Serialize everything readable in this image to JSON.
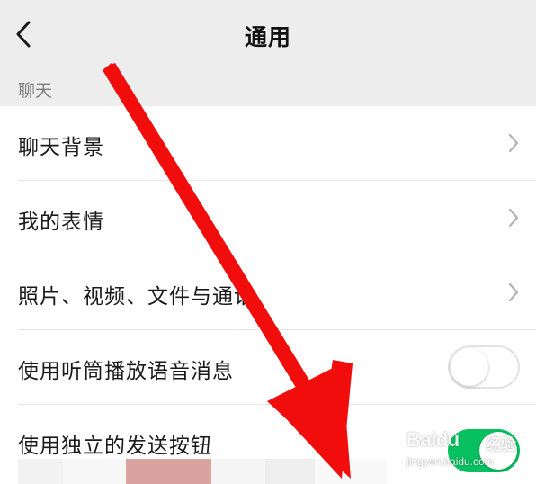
{
  "header": {
    "title": "通用",
    "back_icon": "chevron-left-icon"
  },
  "section": {
    "label": "聊天"
  },
  "rows": [
    {
      "label": "聊天背景",
      "control": "chevron"
    },
    {
      "label": "我的表情",
      "control": "chevron"
    },
    {
      "label": "照片、视频、文件与通话",
      "control": "chevron"
    },
    {
      "label": "使用听筒播放语音消息",
      "control": "toggle",
      "state": "off"
    },
    {
      "label": "使用独立的发送按钮",
      "control": "toggle",
      "state": "on"
    }
  ],
  "colors": {
    "background": "#ededed",
    "list_background": "#ffffff",
    "toggle_on": "#07c160",
    "annotation_arrow": "#f20d0d",
    "section_label": "#7f7f7f"
  },
  "watermark": {
    "logo": "Baidu",
    "logo_suffix": "经验",
    "url": "jingyan.baidu.com"
  }
}
